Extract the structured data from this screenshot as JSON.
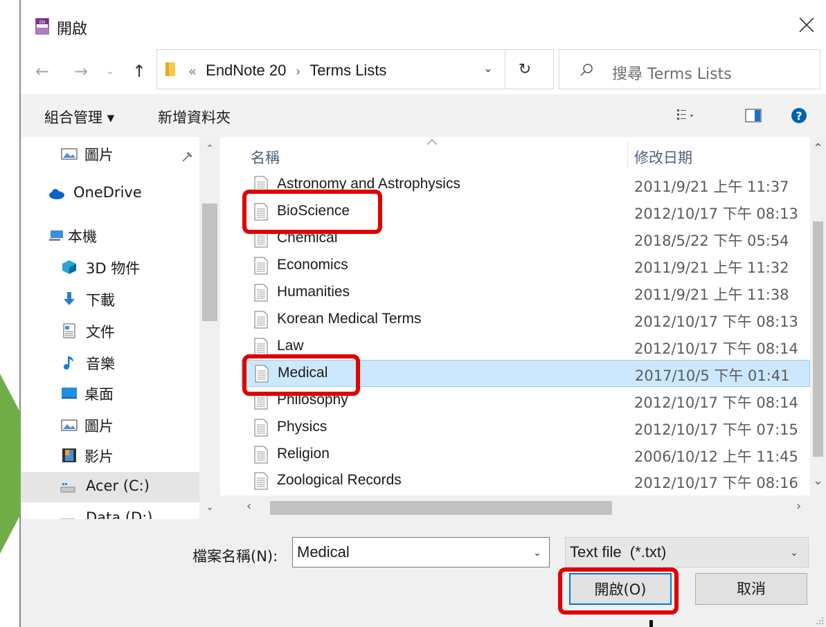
{
  "colors": {
    "highlight": "#e00000",
    "arrow": "#70ad47",
    "selected_row": "#cce8ff",
    "help": "#0063b1"
  },
  "window": {
    "title": "開啟",
    "app_icon": "endnote-icon"
  },
  "address": {
    "prefix": "«",
    "crumbs": [
      "EndNote 20",
      "Terms Lists"
    ],
    "separator": "›"
  },
  "search": {
    "placeholder": "搜尋 Terms Lists"
  },
  "toolbar": {
    "organize": "組合管理 ▾",
    "new_folder": "新增資料夾"
  },
  "nav": {
    "items": [
      {
        "label": "圖片",
        "icon": "pictures-icon"
      },
      {
        "label": "OneDrive",
        "icon": "onedrive-icon"
      },
      {
        "label": "本機",
        "icon": "this-pc-icon"
      },
      {
        "label": "3D 物件",
        "icon": "3d-objects-icon"
      },
      {
        "label": "下載",
        "icon": "downloads-icon"
      },
      {
        "label": "文件",
        "icon": "documents-icon"
      },
      {
        "label": "音樂",
        "icon": "music-icon"
      },
      {
        "label": "桌面",
        "icon": "desktop-icon"
      },
      {
        "label": "圖片",
        "icon": "pictures-icon"
      },
      {
        "label": "影片",
        "icon": "videos-icon"
      },
      {
        "label": "Acer (C:)",
        "icon": "drive-icon"
      },
      {
        "label": "Data (D:)",
        "icon": "drive-icon"
      }
    ]
  },
  "files": {
    "headers": {
      "name": "名稱",
      "date": "修改日期"
    },
    "rows": [
      {
        "name": "Astronomy and Astrophysics",
        "date": "2011/9/21 上午 11:37"
      },
      {
        "name": "BioScience",
        "date": "2012/10/17 下午 08:13"
      },
      {
        "name": "Chemical",
        "date": "2018/5/22 下午 05:54"
      },
      {
        "name": "Economics",
        "date": "2011/9/21 上午 11:32"
      },
      {
        "name": "Humanities",
        "date": "2011/9/21 上午 11:38"
      },
      {
        "name": "Korean Medical Terms",
        "date": "2012/10/17 下午 08:13"
      },
      {
        "name": "Law",
        "date": "2012/10/17 下午 08:14"
      },
      {
        "name": "Medical",
        "date": "2017/10/5 下午 01:41"
      },
      {
        "name": "Philosophy",
        "date": "2012/10/17 下午 08:14"
      },
      {
        "name": "Physics",
        "date": "2012/10/17 下午 07:15"
      },
      {
        "name": "Religion",
        "date": "2006/10/12 上午 11:45"
      },
      {
        "name": "Zoological Records",
        "date": "2012/10/17 下午 08:16"
      }
    ],
    "selected": "Medical"
  },
  "footer": {
    "filename_label": "檔案名稱(N):",
    "filename_value": "Medical",
    "filetype": "Text file  (*.txt)",
    "open_button": "開啟(O)",
    "cancel_button": "取消"
  }
}
